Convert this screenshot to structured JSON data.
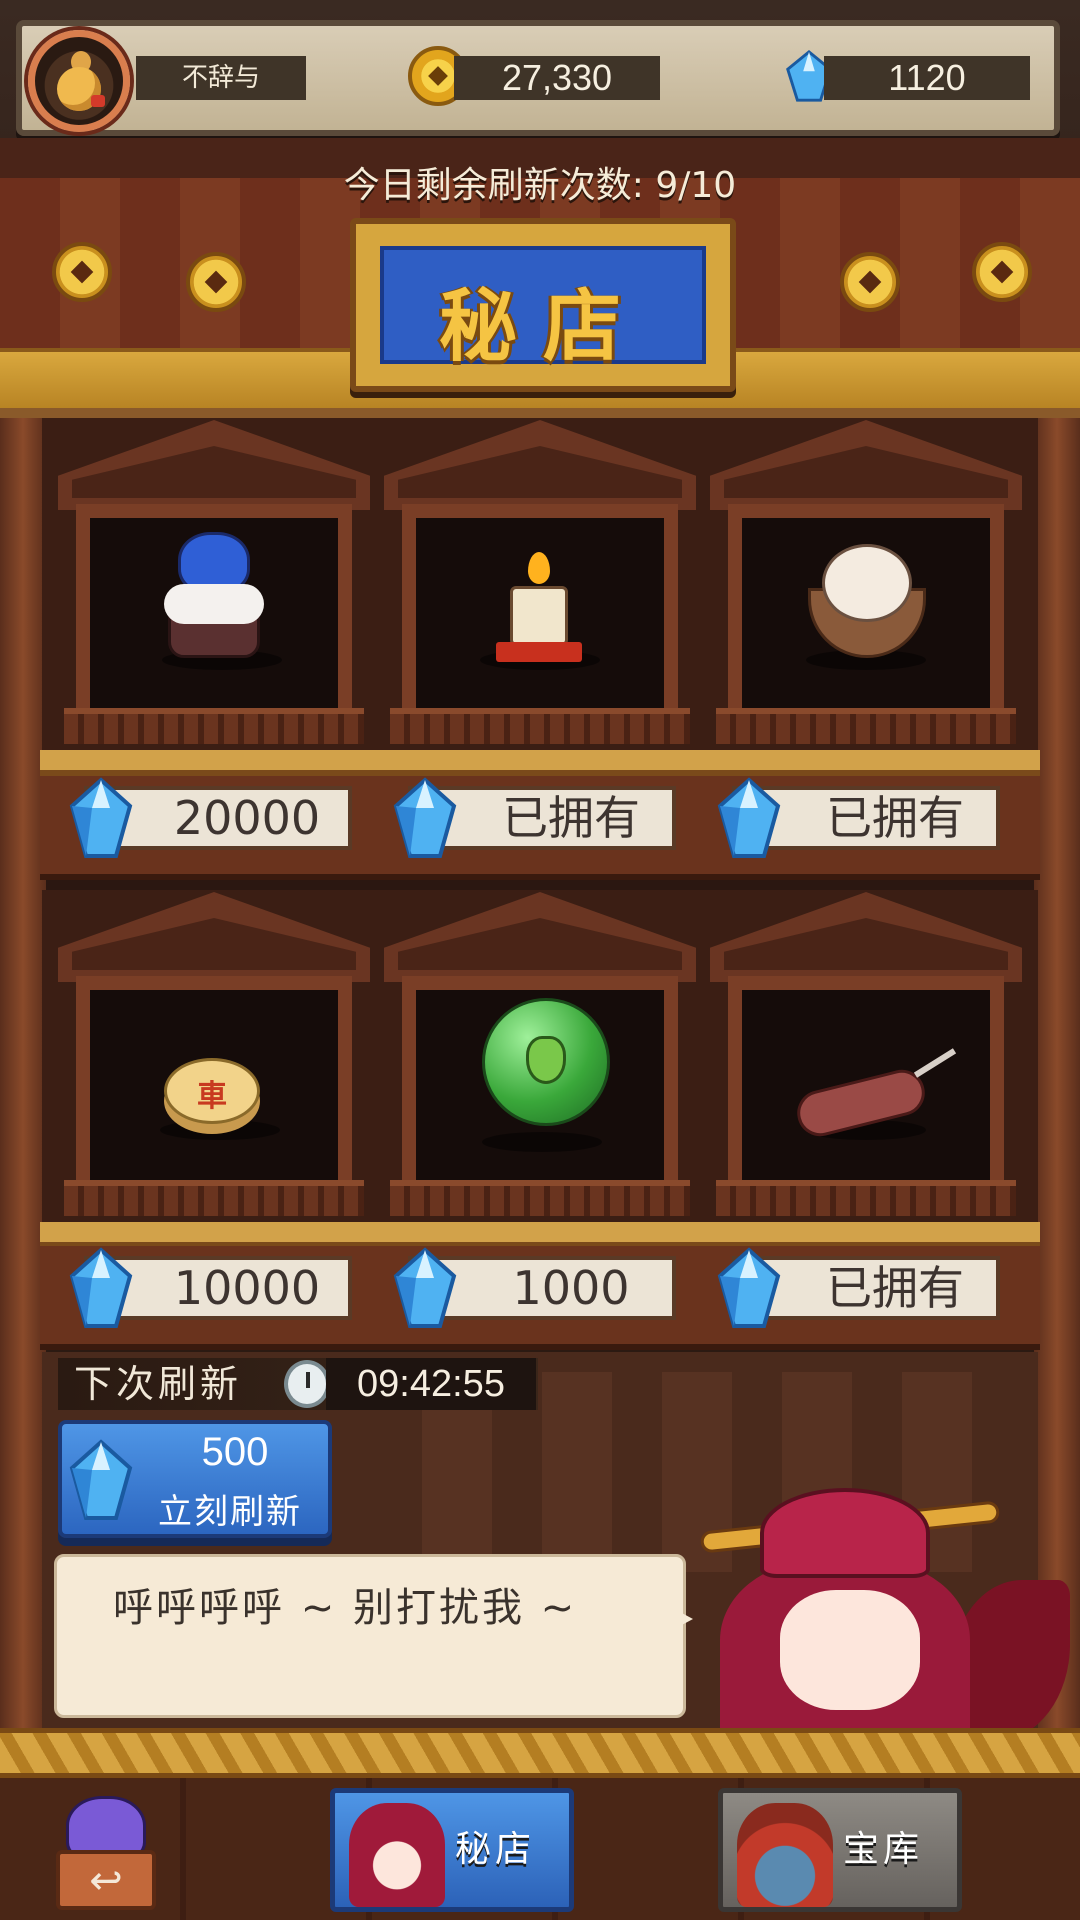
{
  "player": {
    "name": "不辞与"
  },
  "currency": {
    "coins": "27,330",
    "gems": "1120"
  },
  "header": {
    "refresh_count": "今日剩余刷新次数: 9/10",
    "shop_title": "秘店"
  },
  "shop_items": [
    {
      "item_icon": "blue-cake-icon",
      "price": "20000"
    },
    {
      "item_icon": "candle-icon",
      "price": "已拥有"
    },
    {
      "item_icon": "coconut-egg-icon",
      "price": "已拥有"
    },
    {
      "item_icon": "chess-piece-icon",
      "piece_char": "車",
      "price": "10000"
    },
    {
      "item_icon": "green-bubble-icon",
      "price": "1000"
    },
    {
      "item_icon": "sausage-icon",
      "price": "已拥有"
    }
  ],
  "refresh": {
    "label": "下次刷新",
    "timer": "09:42:55",
    "cost": "500",
    "action": "立刻刷新"
  },
  "dialog": {
    "text": "呼呼呼呼 ~ 别打扰我 ~"
  },
  "nav": {
    "back_icon": "back-arrow-icon",
    "back_glyph": "↩",
    "shop_tab": "秘店",
    "vault_tab": "宝库"
  },
  "colors": {
    "gem_blue": "#3a9ae8",
    "coin_gold": "#f2c94a",
    "tab_active": "#2c66c0",
    "tab_inactive": "#66625e"
  }
}
